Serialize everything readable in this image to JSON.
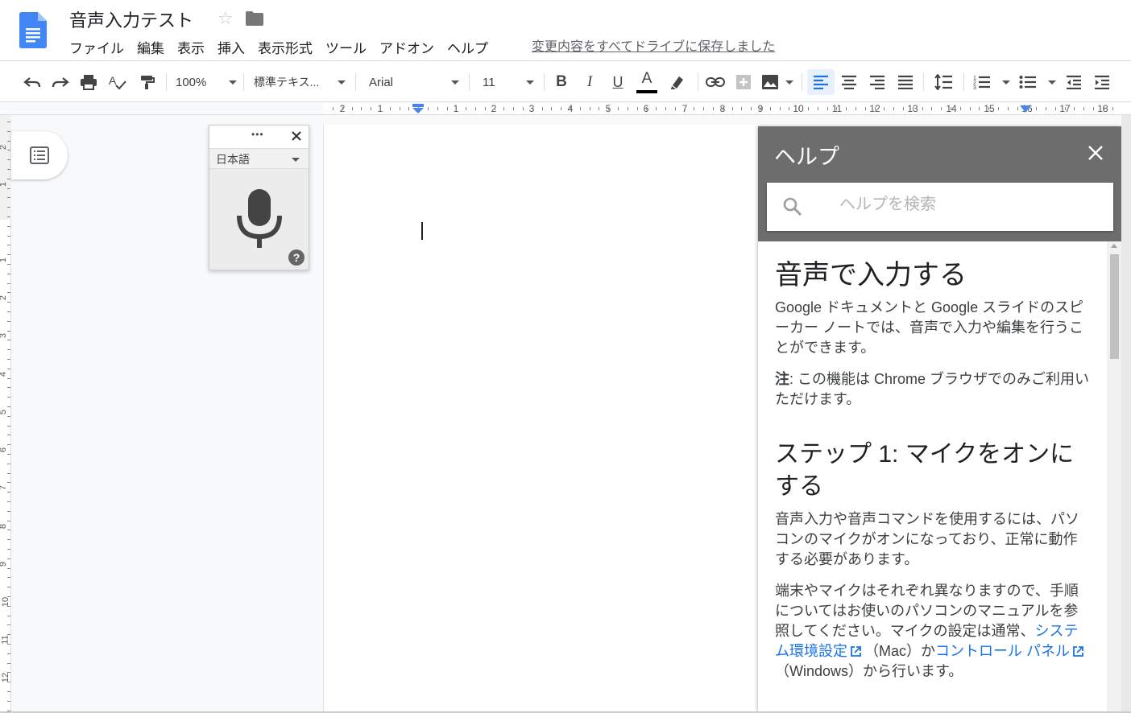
{
  "header": {
    "title": "音声入力テスト",
    "save_status": "変更内容をすべてドライブに保存しました",
    "menu": [
      "ファイル",
      "編集",
      "表示",
      "挿入",
      "表示形式",
      "ツール",
      "アドオン",
      "ヘルプ"
    ]
  },
  "toolbar": {
    "zoom": "100%",
    "style": "標準テキス...",
    "font": "Arial",
    "font_size": "11",
    "bold": "B",
    "italic": "I",
    "underline": "U",
    "text_color_glyph": "A"
  },
  "ruler": {
    "h_labels": [
      "2",
      "1",
      "",
      "1",
      "2",
      "3",
      "4",
      "5",
      "6",
      "7",
      "8",
      "9",
      "10",
      "11",
      "12",
      "13",
      "14",
      "15",
      "16",
      "17",
      "18"
    ],
    "v_labels": [
      "2",
      "1",
      "1",
      "2",
      "3",
      "4",
      "5",
      "6",
      "7",
      "8",
      "9",
      "10",
      "11",
      "12"
    ]
  },
  "voice": {
    "language": "日本語",
    "help_glyph": "?",
    "more_glyph": "•••"
  },
  "help": {
    "title": "ヘルプ",
    "search_placeholder": "ヘルプを検索",
    "heading1": "音声で入力する",
    "p1": "Google ドキュメントと Google スライドのスピーカー ノートでは、音声で入力や編集を行うことができます。",
    "note_label": "注",
    "note_text": ": この機能は Chrome ブラウザでのみご利用いただけます。",
    "heading2": "ステップ 1: マイクをオンにする",
    "p2": "音声入力や音声コマンドを使用するには、パソコンのマイクがオンになっており、正常に動作する必要があります。",
    "p3_a": "端末やマイクはそれぞれ異なりますので、手順についてはお使いのパソコンのマニュアルを参照してください。マイクの設定は通常、",
    "link1": "システム環境設定",
    "p3_b": "（Mac）か",
    "link2": "コントロール パネル",
    "p3_c": "（Windows）から行います。"
  },
  "colors": {
    "accent": "#1a73e8",
    "help_header": "#6d6d6d",
    "doc_icon": "#4285f4"
  }
}
